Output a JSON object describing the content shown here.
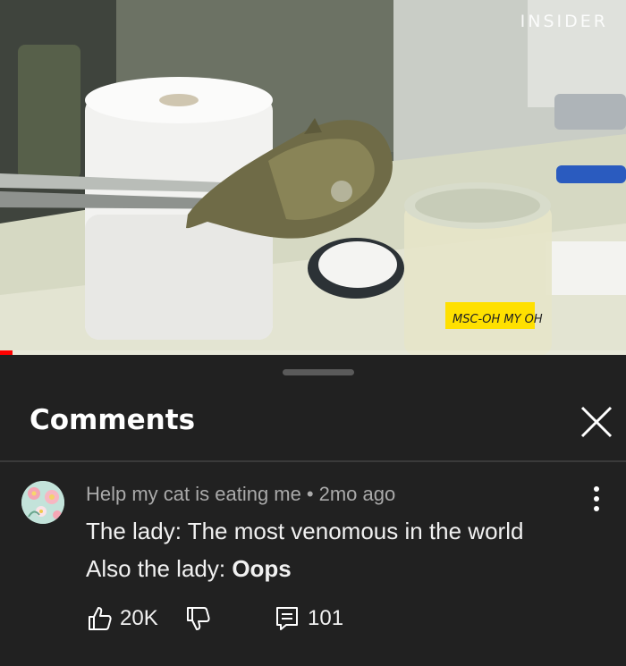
{
  "video": {
    "watermark": "INSIDER",
    "progress": 0.02,
    "jar_label": "MSC-OH MY OH"
  },
  "panel": {
    "title": "Comments",
    "close_icon": "close-icon"
  },
  "comment": {
    "author": "Help my cat is eating me",
    "separator": "•",
    "time": "2mo ago",
    "line1": "The lady: The most venomous in the world",
    "line2_prefix": "Also the lady: ",
    "line2_bold": "Oops",
    "likes": "20K",
    "replies": "101",
    "icons": [
      "thumbs-up-icon",
      "thumbs-down-icon",
      "reply-icon",
      "more-vert-icon"
    ]
  },
  "colors": {
    "background": "#212121",
    "text_primary": "#f1f1f1",
    "text_secondary": "#aaaaaa",
    "progress": "#ff0000"
  }
}
